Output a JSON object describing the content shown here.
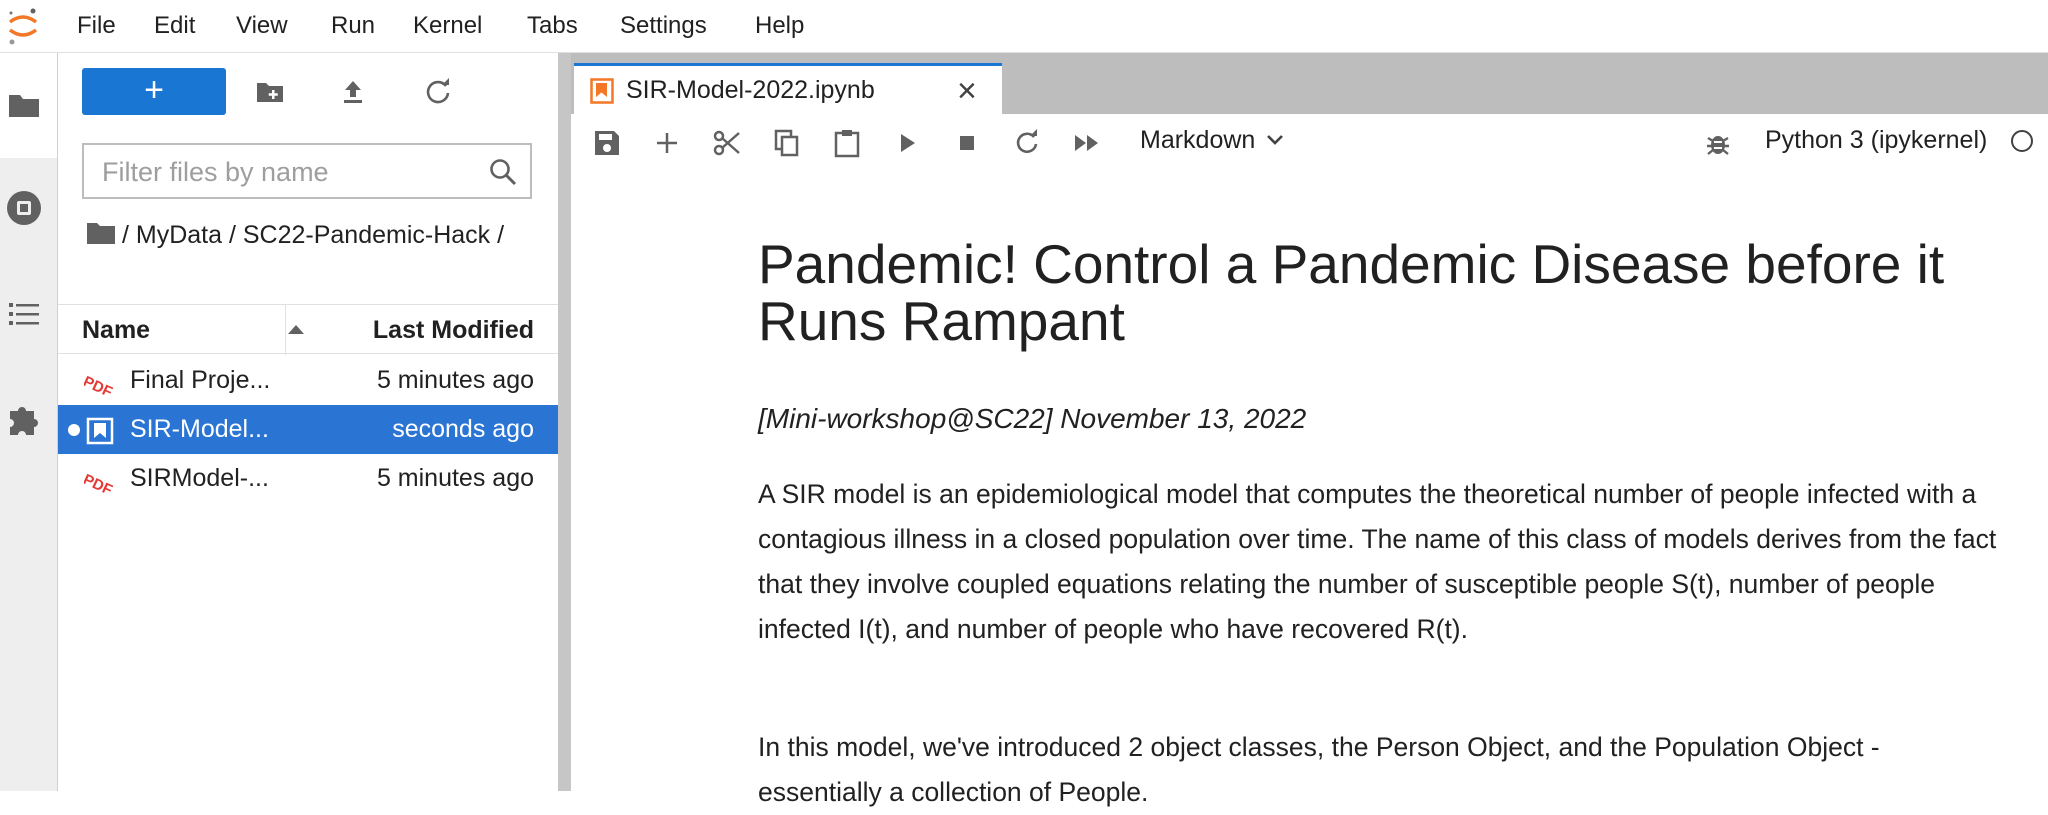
{
  "menubar": {
    "items": [
      "File",
      "Edit",
      "View",
      "Run",
      "Kernel",
      "Tabs",
      "Settings",
      "Help"
    ]
  },
  "filebrowser": {
    "new_button_label": "+",
    "filter_placeholder": "Filter files by name",
    "breadcrumb": "/ MyData / SC22-Pandemic-Hack /",
    "columns": {
      "name": "Name",
      "modified": "Last Modified"
    },
    "files": [
      {
        "name": "Final Proje...",
        "modified": "5 minutes ago",
        "type": "pdf"
      },
      {
        "name": "SIR-Model...",
        "modified": "seconds ago",
        "type": "notebook"
      },
      {
        "name": "SIRModel-...",
        "modified": "5 minutes ago",
        "type": "pdf"
      }
    ]
  },
  "tab": {
    "label": "SIR-Model-2022.ipynb",
    "close": "×"
  },
  "toolbar": {
    "cell_type": "Markdown",
    "kernel": "Python 3 (ipykernel)"
  },
  "notebook": {
    "title": "Pandemic! Control a Pandemic Disease before it Runs Rampant",
    "subtitle": "[Mini-workshop@SC22] November 13, 2022",
    "paragraph1": "A SIR model is an epidemiological model that computes the theoretical number of people infected with a contagious illness in a closed population over time. The name of this class of models derives from the fact that they involve coupled equations relating the number of susceptible people S(t), number of people infected I(t), and number of people who have recovered R(t).",
    "paragraph2": "In this model, we've introduced 2 object classes, the Person Object, and the Population Object - essentially a collection of People."
  },
  "colors": {
    "accent": "#1976d2",
    "selected_row": "#2a75d4",
    "pdf": "#e53935",
    "notebook": "#f37726"
  }
}
